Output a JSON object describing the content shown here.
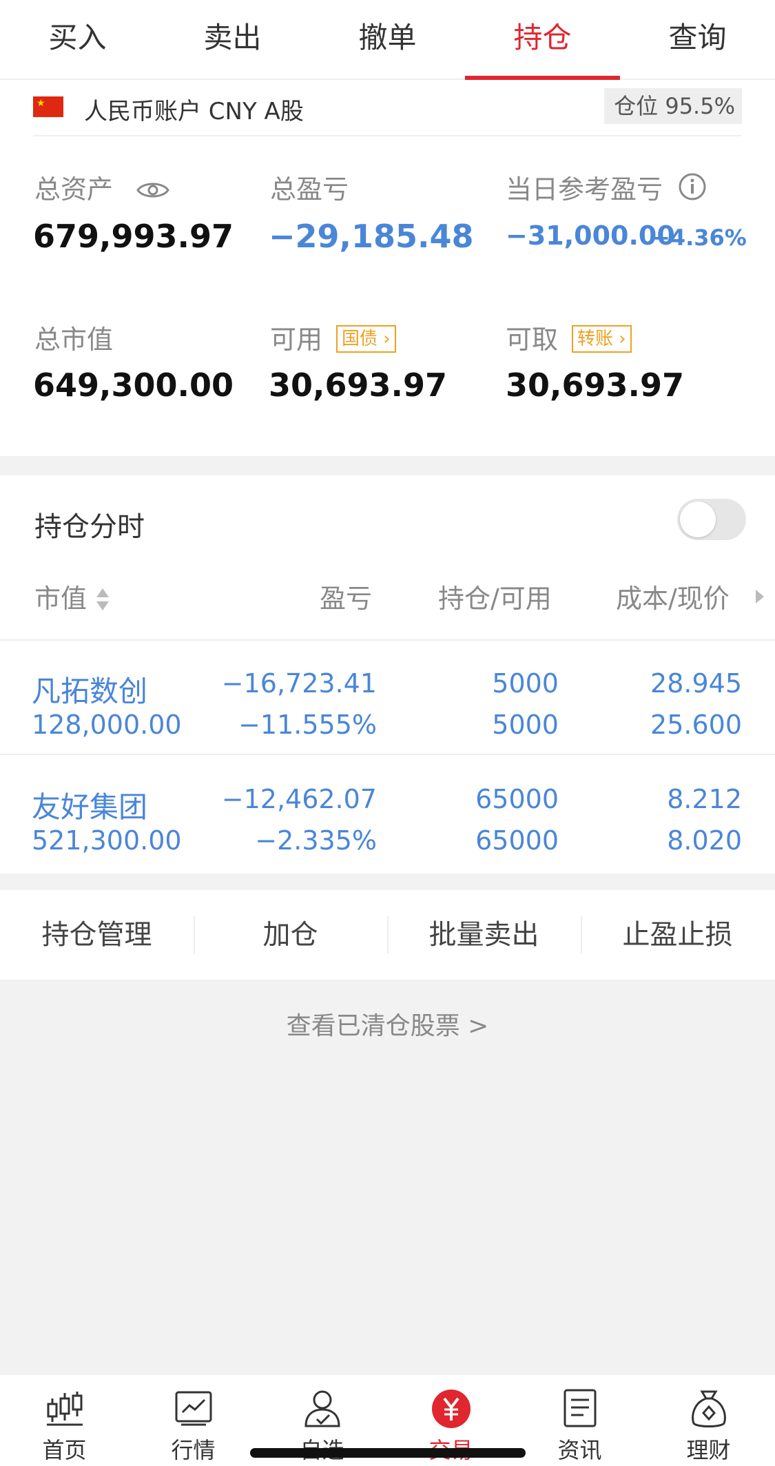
{
  "tabs": [
    {
      "label": "买入"
    },
    {
      "label": "卖出"
    },
    {
      "label": "撤单"
    },
    {
      "label": "持仓"
    },
    {
      "label": "查询"
    }
  ],
  "account": {
    "name": "人民币账户 CNY A股",
    "position_label": "仓位 95.5%"
  },
  "summary": {
    "total_assets_label": "总资产",
    "total_assets": "679,993.97",
    "total_pnl_label": "总盈亏",
    "total_pnl": "−29,185.48",
    "daily_pnl_label": "当日参考盈亏",
    "daily_pnl": "−31,000.00",
    "daily_pnl_pct": "−4.36%",
    "market_value_label": "总市值",
    "market_value": "649,300.00",
    "available_label": "可用",
    "available_tag": "国债",
    "available": "30,693.97",
    "withdrawable_label": "可取",
    "withdrawable_tag": "转账",
    "withdrawable": "30,693.97"
  },
  "holdings": {
    "title": "持仓分时",
    "columns": [
      "市值",
      "盈亏",
      "持仓/可用",
      "成本/现价"
    ],
    "rows": [
      {
        "name": "凡拓数创",
        "market_value": "128,000.00",
        "pnl": "−16,723.41",
        "pnl_pct": "−11.555%",
        "holding": "5000",
        "available": "5000",
        "cost": "28.945",
        "price": "25.600"
      },
      {
        "name": "友好集团",
        "market_value": "521,300.00",
        "pnl": "−12,462.07",
        "pnl_pct": "−2.335%",
        "holding": "65000",
        "available": "65000",
        "cost": "8.212",
        "price": "8.020"
      }
    ]
  },
  "actions": [
    "持仓管理",
    "加仓",
    "批量卖出",
    "止盈止损"
  ],
  "cleared_link": "查看已清仓股票 >",
  "bottom_nav": [
    {
      "label": "首页",
      "icon": "candlestick-icon"
    },
    {
      "label": "行情",
      "icon": "chart-icon"
    },
    {
      "label": "自选",
      "icon": "person-check-icon"
    },
    {
      "label": "交易",
      "icon": "yuan-icon"
    },
    {
      "label": "资讯",
      "icon": "document-icon"
    },
    {
      "label": "理财",
      "icon": "money-bag-icon"
    }
  ],
  "colors": {
    "accent": "#e0262e",
    "loss": "#4a86d8",
    "tag": "#f0a020"
  }
}
